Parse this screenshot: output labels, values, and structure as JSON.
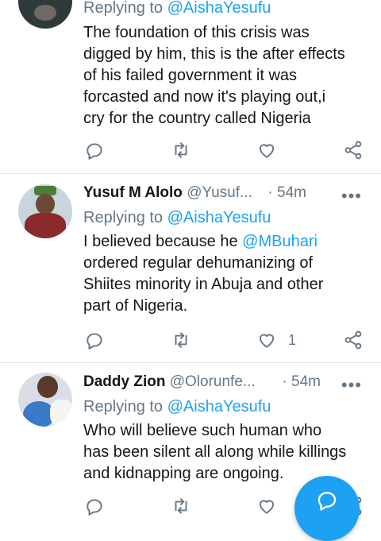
{
  "tweets": [
    {
      "reply_prefix": "Replying to",
      "reply_to": "@AishaYesufu",
      "body_lines": [
        "The foundation of this crisis was",
        "digged by him, this is the after effects",
        "of his failed government it was",
        "forcasted and now it's playing out,i",
        "cry for the country called Nigeria"
      ],
      "like_count": ""
    },
    {
      "name": "Yusuf M Alolo",
      "handle": "@Yusuf...",
      "dot": "·",
      "time": "54m",
      "more": "•••",
      "reply_prefix": "Replying to",
      "reply_to": "@AishaYesufu",
      "body_pre": "I believed because he ",
      "body_mention": "@MBuhari",
      "body_lines": [
        "ordered regular dehumanizing of",
        "Shiites minority in Abuja and other",
        "part of Nigeria."
      ],
      "like_count": "1"
    },
    {
      "name": "Daddy Zion",
      "handle": "@Olorunfe...",
      "dot": "·",
      "time": "54m",
      "more": "•••",
      "reply_prefix": "Replying to",
      "reply_to": "@AishaYesufu",
      "body_lines": [
        "Who will believe such human who",
        "has been silent all along while killings",
        "and kidnapping are ongoing."
      ],
      "like_count": ""
    }
  ],
  "icons": {
    "reply": "reply-icon",
    "retweet": "retweet-icon",
    "like": "heart-icon",
    "share": "share-icon",
    "compose": "compose-icon"
  },
  "colors": {
    "accent": "#1da1f2",
    "text": "#14171a",
    "muted": "#657786",
    "divider": "#e1e8ed"
  }
}
